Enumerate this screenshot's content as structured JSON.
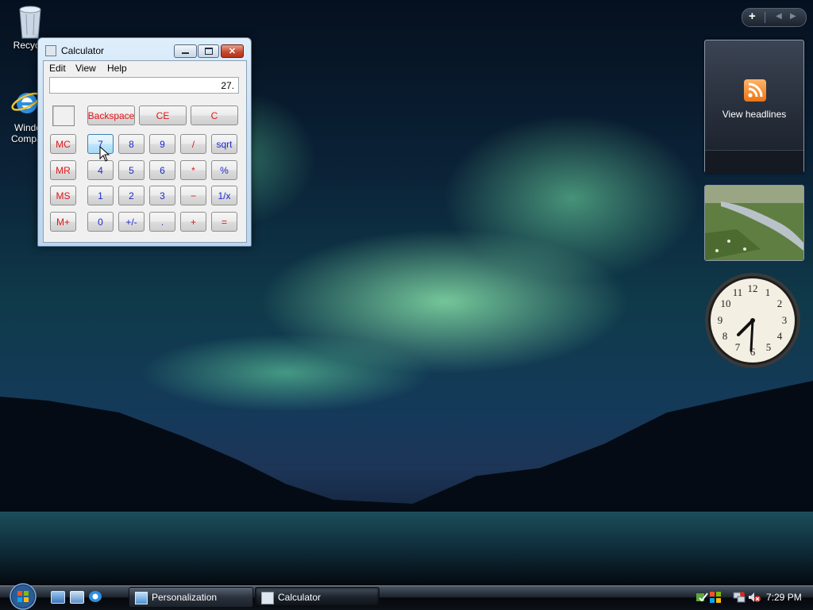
{
  "desktop": {
    "icons": [
      {
        "label": "Recycle"
      },
      {
        "label_line1": "Windo",
        "label_line2": "Compat"
      }
    ]
  },
  "calculator": {
    "title": "Calculator",
    "menu": [
      "Edit",
      "View",
      "Help"
    ],
    "display": "27.",
    "buttons": {
      "backspace": "Backspace",
      "ce": "CE",
      "c": "C",
      "mc": "MC",
      "mr": "MR",
      "ms": "MS",
      "mplus": "M+",
      "n7": "7",
      "n8": "8",
      "n9": "9",
      "div": "/",
      "sqrt": "sqrt",
      "n4": "4",
      "n5": "5",
      "n6": "6",
      "mul": "*",
      "pct": "%",
      "n1": "1",
      "n2": "2",
      "n3": "3",
      "sub": "−",
      "inv": "1/x",
      "n0": "0",
      "sign": "+/-",
      "dot": ".",
      "add": "+",
      "eq": "="
    }
  },
  "sidebar": {
    "add_button": "+",
    "feed_gadget": {
      "caption": "View headlines"
    },
    "clock": {
      "numbers": [
        "12",
        "1",
        "2",
        "3",
        "4",
        "5",
        "6",
        "7",
        "8",
        "9",
        "10",
        "11"
      ]
    }
  },
  "taskbar": {
    "tasks": [
      {
        "label": "Personalization"
      },
      {
        "label": "Calculator"
      }
    ],
    "clock": "7:29 PM"
  },
  "colors": {
    "calc_red": "#e0161b",
    "calc_blue": "#1b2bcc",
    "aurora_green": "#96f5b4"
  }
}
